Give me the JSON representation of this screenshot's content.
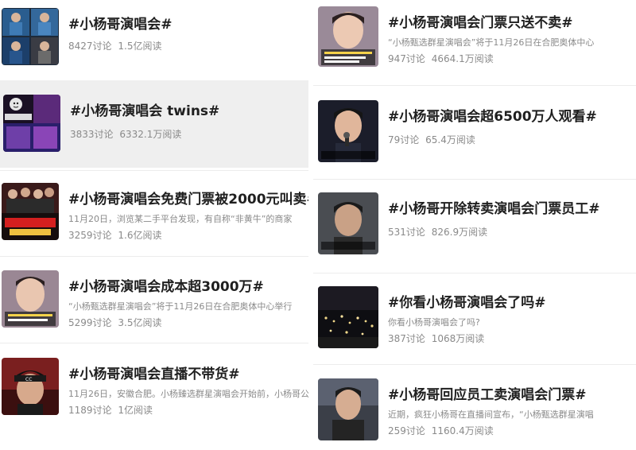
{
  "left": [
    {
      "title": "#小杨哥演唱会#",
      "excerpt": "",
      "discussions": "8427讨论",
      "reads": "1.5亿阅读",
      "thumb_icon": "collage-thumbnail",
      "thumb_overlay": ""
    },
    {
      "title": "#小杨哥演唱会 twins#",
      "excerpt": "",
      "discussions": "3833讨论",
      "reads": "6332.1万阅读",
      "thumb_icon": "concert-stage-thumbnail",
      "thumb_overlay": "歌曲..都出来"
    },
    {
      "title": "#小杨哥演唱会免费门票被2000元叫卖#",
      "excerpt": "11月20日，浏览某二手平台发现，有自称“非黄牛”的商家",
      "discussions": "3259讨论",
      "reads": "1.6亿阅读",
      "thumb_icon": "concert-poster-thumbnail",
      "thumb_overlay": "小杨哥群星演唱会"
    },
    {
      "title": "#小杨哥演唱会成本超3000万#",
      "excerpt": "“小杨甄选群星演唱会”将于11月26日在合肥奥体中心举行",
      "discussions": "5299讨论",
      "reads": "3.5亿阅读",
      "thumb_icon": "selfie-video-thumbnail",
      "thumb_overlay": ""
    },
    {
      "title": "#小杨哥演唱会直播不带货#",
      "excerpt": "11月26日，安徽合肥。小杨臻选群星演唱会开始前，小杨哥公",
      "discussions": "1189讨论",
      "reads": "1亿阅读",
      "thumb_icon": "beanie-portrait-thumbnail",
      "thumb_overlay": ""
    }
  ],
  "right": [
    {
      "title": "#小杨哥演唱会门票只送不卖#",
      "excerpt": "“小杨甄选群星演唱会”将于11月26日在合肥奥体中心",
      "discussions": "947讨论",
      "reads": "4664.1万阅读",
      "thumb_icon": "selfie-video-thumbnail",
      "thumb_overlay": ""
    },
    {
      "title": "#小杨哥演唱会超6500万人观看#",
      "excerpt": "",
      "discussions": "79讨论",
      "reads": "65.4万阅读",
      "thumb_icon": "singer-microphone-thumbnail",
      "thumb_overlay": ""
    },
    {
      "title": "#小杨哥开除转卖演唱会门票员工#",
      "excerpt": "",
      "discussions": "531讨论",
      "reads": "826.9万阅读",
      "thumb_icon": "portrait-thumbnail",
      "thumb_overlay": "还有卖2000元 1000元的"
    },
    {
      "title": "#你看小杨哥演唱会了吗#",
      "excerpt": "你看小杨哥演唱会了吗?",
      "discussions": "387讨论",
      "reads": "1068万阅读",
      "thumb_icon": "stadium-crowd-thumbnail",
      "thumb_overlay": ""
    },
    {
      "title": "#小杨哥回应员工卖演唱会门票#",
      "excerpt": "近期，疯狂小杨哥在直播间宣布，“小杨甄选群星演唱",
      "discussions": "259讨论",
      "reads": "1160.4万阅读",
      "thumb_icon": "outdoor-portrait-thumbnail",
      "thumb_overlay": ""
    }
  ]
}
